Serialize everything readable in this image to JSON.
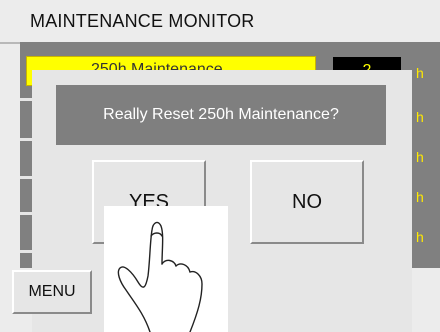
{
  "title": "MAINTENANCE MONITOR",
  "background": {
    "highlighted_row_label": "250h Maintenance",
    "highlighted_row_counter": "2",
    "unit_labels": [
      "h",
      "h",
      "h",
      "h",
      "h"
    ]
  },
  "dialog": {
    "message": "Really Reset 250h Maintenance?",
    "yes_label": "YES",
    "no_label": "NO"
  },
  "menu_label": "MENU",
  "colors": {
    "panel_gray": "#808080",
    "highlight_yellow": "#ffff00",
    "unit_yellow": "#ffea00"
  },
  "icons": [
    "pointing-hand-icon"
  ]
}
